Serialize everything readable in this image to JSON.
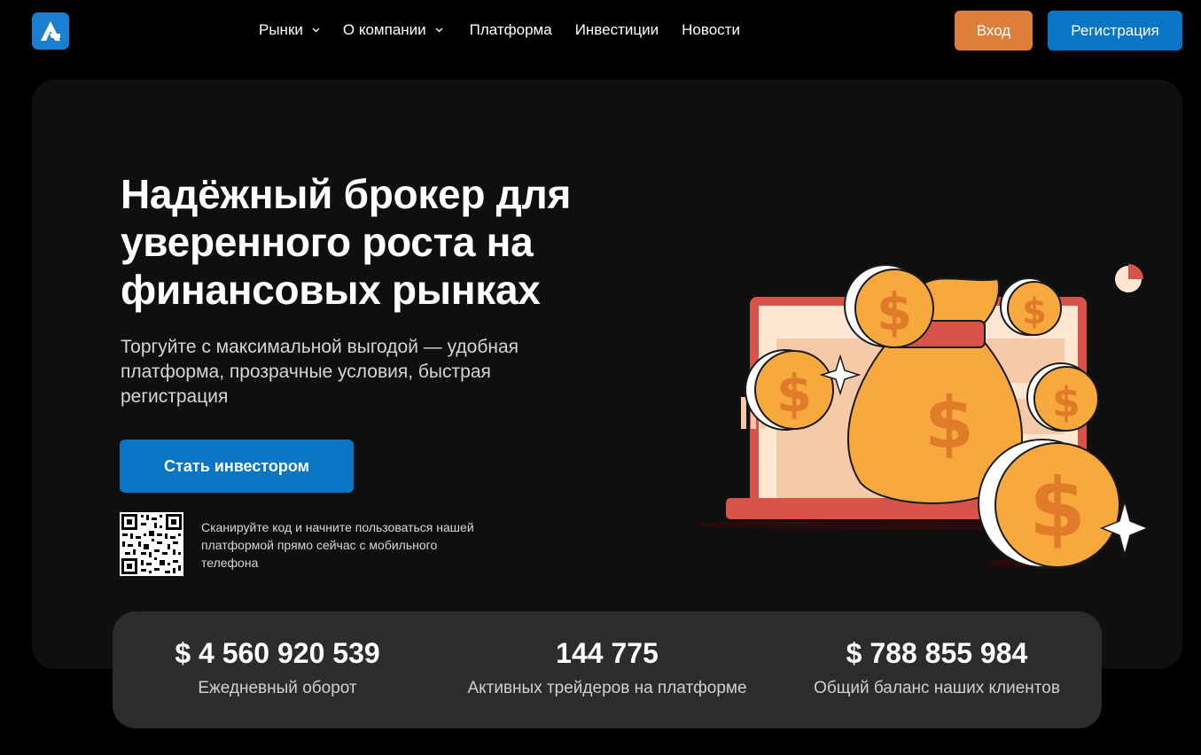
{
  "header": {
    "logo_icon": "brand-a-logo",
    "nav": [
      {
        "label": "Рынки",
        "has_dropdown": true
      },
      {
        "label": "О компании",
        "has_dropdown": true
      },
      {
        "label": "Платформа",
        "has_dropdown": false
      },
      {
        "label": "Инвестиции",
        "has_dropdown": false
      },
      {
        "label": "Новости",
        "has_dropdown": false
      }
    ],
    "login_label": "Вход",
    "register_label": "Регистрация"
  },
  "hero": {
    "title": "Надёжный брокер для уверенного роста на финансовых рынках",
    "subtitle": "Торгуйте с максимальной выгодой — удобная платформа, прозрачные условия, быстрая регистрация",
    "cta_label": "Стать инвестором",
    "qr_icon": "qr-code",
    "qr_text": "Сканируйте код и начните пользоваться нашей платформой прямо сейчас с мобильного телефона",
    "illustration": "money-bag-laptop-coins"
  },
  "stats": [
    {
      "value": "$ 4 560 920 539",
      "label": "Ежедневный оборот"
    },
    {
      "value": "144 775",
      "label": "Активных трейдеров на платформе"
    },
    {
      "value": "$ 788 855 984",
      "label": "Общий баланс наших клиентов"
    }
  ],
  "colors": {
    "accent_blue": "#0876c5",
    "accent_orange": "#dd7f3a",
    "coin_orange": "#f7a93e",
    "laptop_red": "#d9534a"
  }
}
